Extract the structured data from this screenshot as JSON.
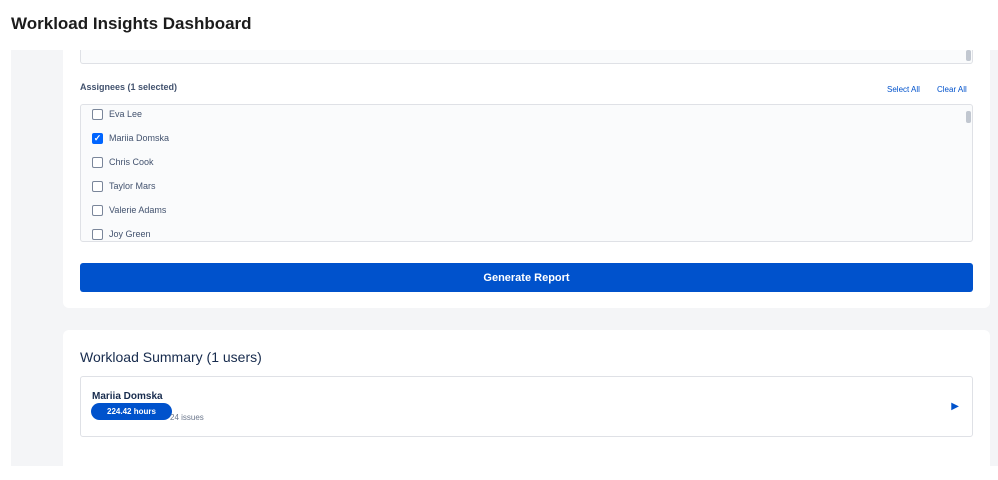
{
  "header": {
    "title": "Workload Insights Dashboard"
  },
  "filters": {
    "assignees_label": "Assignees (1 selected)",
    "select_all": "Select All",
    "clear_all": "Clear All",
    "assignees": [
      {
        "name": "Eva Lee",
        "checked": false
      },
      {
        "name": "Mariia Domska",
        "checked": true
      },
      {
        "name": "Chris Cook",
        "checked": false
      },
      {
        "name": "Taylor Mars",
        "checked": false
      },
      {
        "name": "Valerie Adams",
        "checked": false
      },
      {
        "name": "Joy Green",
        "checked": false
      }
    ],
    "generate_label": "Generate Report"
  },
  "summary": {
    "title": "Workload Summary (1 users)",
    "users": [
      {
        "name": "Mariia Domska",
        "hours": "224.42 hours",
        "issues": "24 issues"
      }
    ]
  },
  "colors": {
    "accent": "#0052cc",
    "background": "#f4f5f7"
  }
}
